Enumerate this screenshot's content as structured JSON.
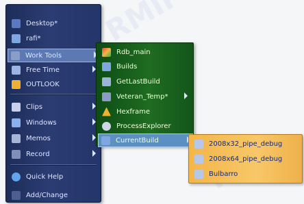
{
  "main_menu": {
    "items": [
      {
        "label": "Desktop*",
        "icon": "desktop-icon",
        "has_submenu": false
      },
      {
        "label": "rafi*",
        "icon": "folder-icon",
        "has_submenu": false
      },
      {
        "label": "Work Tools",
        "icon": "work-tools-icon",
        "has_submenu": true,
        "selected": true
      },
      {
        "label": "Free Time",
        "icon": "free-time-icon",
        "has_submenu": true
      },
      {
        "label": "OUTLOOK",
        "icon": "outlook-icon",
        "has_submenu": false
      },
      {
        "label": "Clips",
        "icon": "clips-icon",
        "has_submenu": true
      },
      {
        "label": "Windows",
        "icon": "windows-icon",
        "has_submenu": true
      },
      {
        "label": "Memos",
        "icon": "memos-icon",
        "has_submenu": true
      },
      {
        "label": "Record",
        "icon": "record-icon",
        "has_submenu": true
      },
      {
        "label": "Quick Help",
        "icon": "help-icon",
        "has_submenu": false
      },
      {
        "label": "Add/Change",
        "icon": "add-change-icon",
        "has_submenu": false
      }
    ]
  },
  "work_tools_menu": {
    "items": [
      {
        "label": "Rdb_main",
        "icon": "chart-icon"
      },
      {
        "label": "Builds",
        "icon": "folder-icon"
      },
      {
        "label": "GetLastBuild",
        "icon": "document-icon"
      },
      {
        "label": "Veteran_Temp*",
        "icon": "tools-icon",
        "has_submenu": true
      },
      {
        "label": "Hexframe",
        "icon": "warning-icon"
      },
      {
        "label": "ProcessExplorer",
        "icon": "gear-icon"
      },
      {
        "label": "CurrentBuild",
        "icon": "folder-icon",
        "has_submenu": true,
        "selected": true
      }
    ]
  },
  "current_build_menu": {
    "items": [
      {
        "label": "2008x32_pipe_debug",
        "icon": "app-icon"
      },
      {
        "label": "2008x64_pipe_debug",
        "icon": "app-icon"
      },
      {
        "label": "Bulbarro",
        "icon": "app-icon"
      }
    ]
  },
  "colors": {
    "main_menu_bg": "#24356a",
    "work_tools_bg": "#1f6c22",
    "current_build_bg": "#f8c768",
    "selection_bg": "#5c79b3"
  },
  "watermark": "RMIP"
}
